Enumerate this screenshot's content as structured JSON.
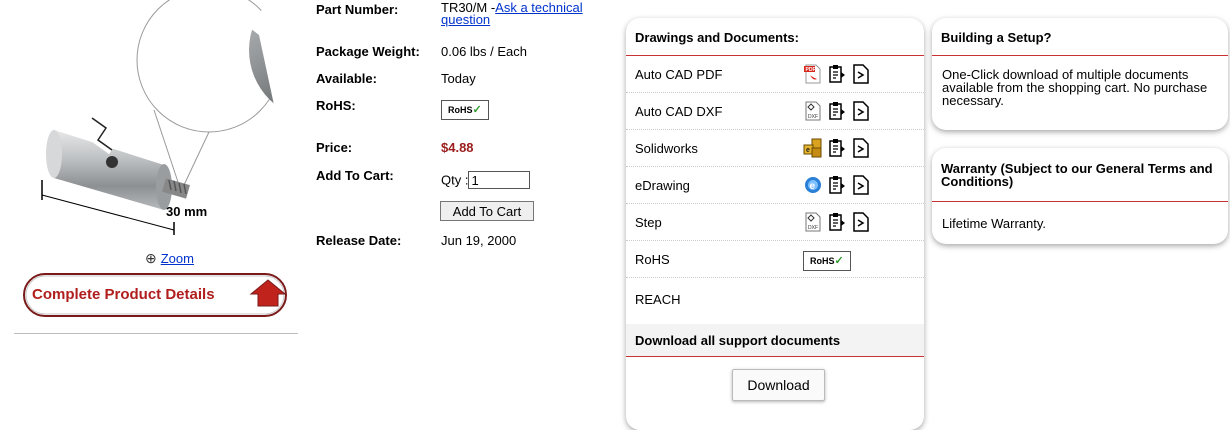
{
  "product": {
    "dimension_label": "30 mm",
    "zoom_label": "Zoom",
    "details_button": "Complete Product Details"
  },
  "info": {
    "part_number_label": "Part Number:",
    "part_number": "TR30/M -",
    "ask_link": "Ask a technical",
    "ask_link_2": "question",
    "weight_label": "Package Weight:",
    "weight": "0.06 lbs / Each",
    "available_label": "Available:",
    "available": "Today",
    "rohs_label": "RoHS:",
    "rohs_badge": "RoHS",
    "price_label": "Price:",
    "price": "$4.88",
    "cart_label": "Add To Cart:",
    "qty_label": "Qty :",
    "qty_value": "1",
    "add_button": "Add To Cart",
    "release_label": "Release Date:",
    "release_date": "Jun 19, 2000"
  },
  "docs": {
    "title": "Drawings and Documents:",
    "rows": [
      {
        "label": "Auto CAD PDF",
        "icon": "pdf-icon"
      },
      {
        "label": "Auto CAD DXF",
        "icon": "dxf-icon"
      },
      {
        "label": "Solidworks",
        "icon": "solidworks-icon"
      },
      {
        "label": "eDrawing",
        "icon": "edrawing-icon"
      },
      {
        "label": "Step",
        "icon": "dxf-icon"
      },
      {
        "label": "RoHS",
        "icon": "rohs-badge"
      },
      {
        "label": "REACH",
        "icon": ""
      }
    ],
    "rohs_badge": "RoHS",
    "download_all_title": "Download all support documents",
    "download_button": "Download"
  },
  "setup": {
    "title": "Building a Setup?",
    "text": "One-Click download of multiple documents available from the shopping cart. No purchase necessary."
  },
  "warranty": {
    "title": "Warranty (Subject to our General Terms and Conditions)",
    "text": "Lifetime Warranty."
  },
  "colors": {
    "price": "#9a1c1c",
    "card_rule": "#c83232",
    "link": "#0033cc",
    "details_button_text": "#b01e1e"
  }
}
